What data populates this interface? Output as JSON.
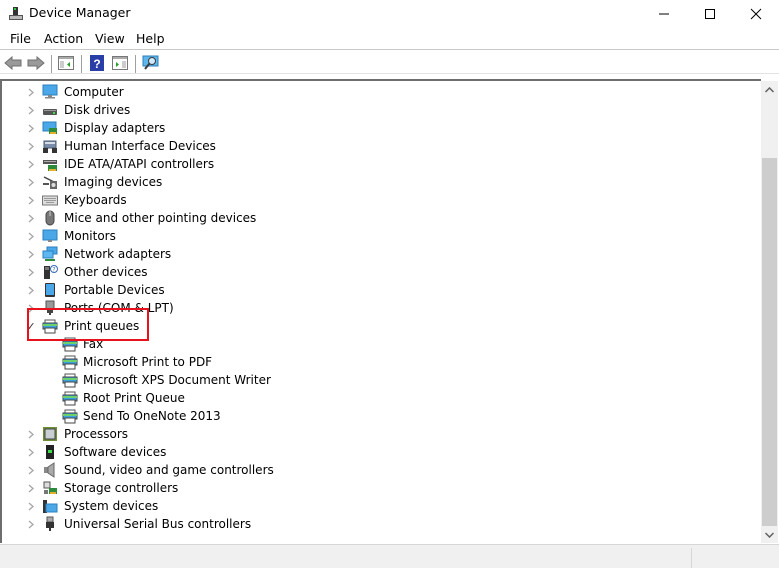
{
  "window": {
    "title": "Device Manager",
    "controls": {
      "minimize": "minimize",
      "maximize": "maximize",
      "close": "close"
    }
  },
  "menu": [
    "File",
    "Action",
    "View",
    "Help"
  ],
  "toolbar": [
    {
      "name": "back",
      "icon": "arrow-left-icon"
    },
    {
      "name": "forward",
      "icon": "arrow-right-icon"
    },
    {
      "name": "show-hide-console-tree",
      "icon": "console-tree-icon"
    },
    {
      "name": "help",
      "icon": "help-icon"
    },
    {
      "name": "show-hide-action-pane",
      "icon": "action-pane-icon"
    },
    {
      "name": "scan-hardware-changes",
      "icon": "scan-monitor-icon"
    }
  ],
  "tree": {
    "categories": [
      {
        "label": "Computer",
        "icon": "computer-icon",
        "expanded": false
      },
      {
        "label": "Disk drives",
        "icon": "disk-drive-icon",
        "expanded": false
      },
      {
        "label": "Display adapters",
        "icon": "display-adapter-icon",
        "expanded": false
      },
      {
        "label": "Human Interface Devices",
        "icon": "hid-icon",
        "expanded": false
      },
      {
        "label": "IDE ATA/ATAPI controllers",
        "icon": "ide-controller-icon",
        "expanded": false
      },
      {
        "label": "Imaging devices",
        "icon": "camera-icon",
        "expanded": false
      },
      {
        "label": "Keyboards",
        "icon": "keyboard-icon",
        "expanded": false
      },
      {
        "label": "Mice and other pointing devices",
        "icon": "mouse-icon",
        "expanded": false
      },
      {
        "label": "Monitors",
        "icon": "monitor-icon",
        "expanded": false
      },
      {
        "label": "Network adapters",
        "icon": "network-adapter-icon",
        "expanded": false
      },
      {
        "label": "Other devices",
        "icon": "unknown-device-icon",
        "expanded": false
      },
      {
        "label": "Portable Devices",
        "icon": "portable-device-icon",
        "expanded": false
      },
      {
        "label": "Ports (COM & LPT)",
        "icon": "port-icon",
        "expanded": false
      },
      {
        "label": "Print queues",
        "icon": "printer-icon",
        "expanded": true,
        "children": [
          "Fax",
          "Microsoft Print to PDF",
          "Microsoft XPS Document Writer",
          "Root Print Queue",
          "Send To OneNote 2013"
        ]
      },
      {
        "label": "Processors",
        "icon": "processor-icon",
        "expanded": false
      },
      {
        "label": "Software devices",
        "icon": "software-device-icon",
        "expanded": false
      },
      {
        "label": "Sound, video and game controllers",
        "icon": "speaker-icon",
        "expanded": false
      },
      {
        "label": "Storage controllers",
        "icon": "storage-controller-icon",
        "expanded": false
      },
      {
        "label": "System devices",
        "icon": "system-device-icon",
        "expanded": false
      },
      {
        "label": "Universal Serial Bus controllers",
        "icon": "usb-icon",
        "expanded": false
      }
    ]
  },
  "highlight": {
    "target": "Print queues",
    "color": "#e8121d"
  },
  "scrollbar": {
    "position_fraction": 0.2
  }
}
